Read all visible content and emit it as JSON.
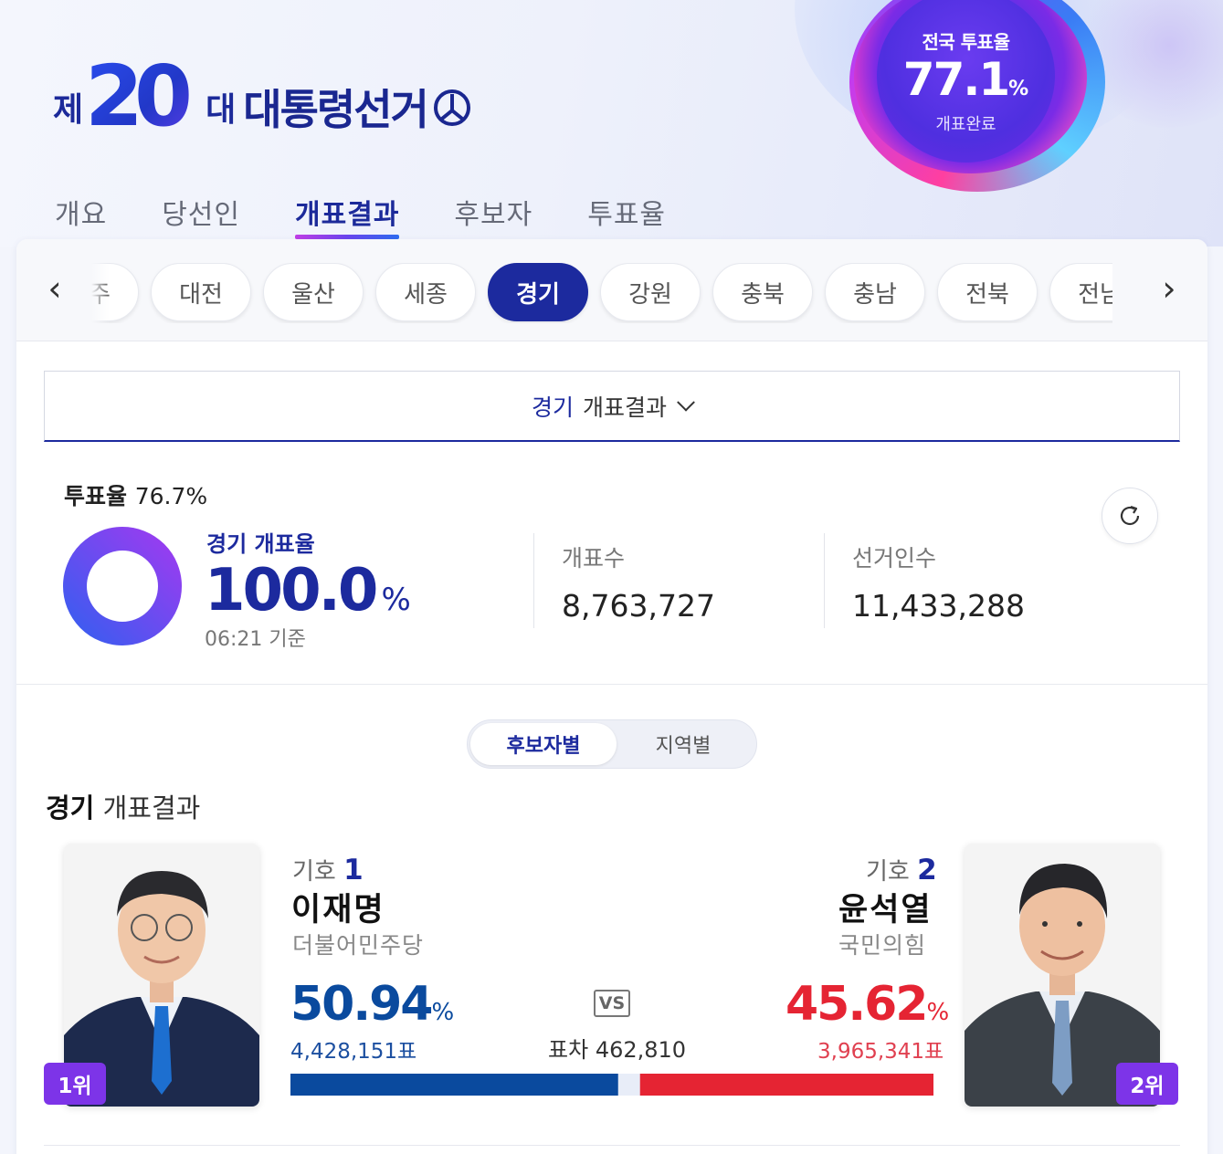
{
  "header": {
    "logo_prefix": "제",
    "logo_number": "20",
    "logo_suffix": "대",
    "logo_title": "대통령선거"
  },
  "national_turnout": {
    "label": "전국 투표율",
    "value": "77.1",
    "unit": "%",
    "status": "개표완료"
  },
  "nav_tabs": [
    {
      "label": "개요",
      "active": false
    },
    {
      "label": "당선인",
      "active": false
    },
    {
      "label": "개표결과",
      "active": true
    },
    {
      "label": "후보자",
      "active": false
    },
    {
      "label": "투표율",
      "active": false
    }
  ],
  "region_chips": [
    {
      "label": "광주",
      "active": false
    },
    {
      "label": "대전",
      "active": false
    },
    {
      "label": "울산",
      "active": false
    },
    {
      "label": "세종",
      "active": false
    },
    {
      "label": "경기",
      "active": true
    },
    {
      "label": "강원",
      "active": false
    },
    {
      "label": "충북",
      "active": false
    },
    {
      "label": "충남",
      "active": false
    },
    {
      "label": "전북",
      "active": false
    },
    {
      "label": "전남",
      "active": false
    }
  ],
  "region_select": {
    "region": "경기",
    "label": "개표결과"
  },
  "summary": {
    "turnout_label": "투표율",
    "turnout_value": "76.7%",
    "count_title": "경기 개표율",
    "count_value": "100.0",
    "count_unit": "%",
    "count_fraction": 1.0,
    "timestamp": "06:21 기준",
    "counted_label": "개표수",
    "counted_value": "8,763,727",
    "electorate_label": "선거인수",
    "electorate_value": "11,433,288"
  },
  "view_toggle": {
    "by_candidate": "후보자별",
    "by_region": "지역별"
  },
  "results_title": {
    "region": "경기",
    "label": "개표결과"
  },
  "candidates": [
    {
      "number_label": "기호",
      "number": "1",
      "name": "이재명",
      "party": "더불어민주당",
      "percent": "50.94",
      "votes": "4,428,151표",
      "rank": "1위",
      "color": "#0a4a9e"
    },
    {
      "number_label": "기호",
      "number": "2",
      "name": "윤석열",
      "party": "국민의힘",
      "percent": "45.62",
      "votes": "3,965,341표",
      "rank": "2위",
      "color": "#e52433"
    }
  ],
  "comparison": {
    "vs": "VS",
    "margin_label": "표차",
    "margin_value": "462,810",
    "share_1": 50.94,
    "share_2": 45.62
  },
  "colors": {
    "brand": "#1c2a9e",
    "accent_purple": "#7d34e8",
    "party_1": "#0a4a9e",
    "party_2": "#e52433"
  }
}
